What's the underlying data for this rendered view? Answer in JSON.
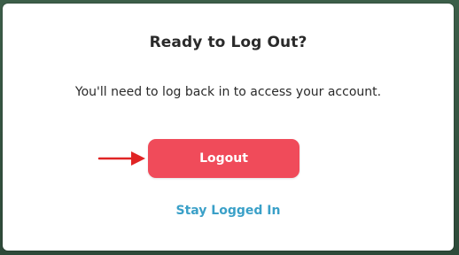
{
  "dialog": {
    "title": "Ready to Log Out?",
    "message": "You'll need to log back in to access your account.",
    "primary_button_label": "Logout",
    "secondary_link_label": "Stay Logged In"
  },
  "colors": {
    "primary_button": "#f04b5a",
    "link": "#3aa0c8",
    "annotation_arrow": "#e02424"
  },
  "icons": {
    "annotation": "arrow-right-icon"
  }
}
